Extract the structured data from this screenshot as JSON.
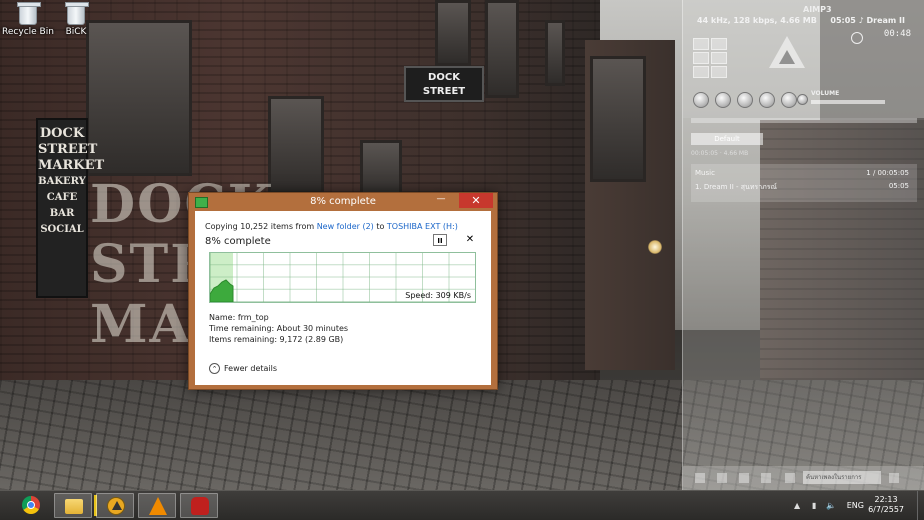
{
  "desktop": {
    "icons": [
      {
        "label": "Recycle Bin",
        "icon": "recycle-bin-icon"
      },
      {
        "label": "BiCK",
        "icon": "recycle-bin-icon"
      }
    ],
    "wallpaper_signs": {
      "board": [
        "DOCK",
        "STREET",
        "MARKET",
        "BAKERY",
        "CAFE",
        "BAR",
        "SOCIAL"
      ],
      "hanging": [
        "DOCK",
        "STREET"
      ],
      "big": [
        "DOCK",
        "STREET",
        "MARKET"
      ]
    }
  },
  "aimp": {
    "info": "44 kHz, 128 kbps, 4.66 MB",
    "logo_text": "AIMP3",
    "now_playing": "05:05 ♪ Dream II",
    "clock": "00:48",
    "volume_label": "VOLUME",
    "preset": "Default",
    "playlist_header": "00:05:05   ·   4.66 MB",
    "playlist_name": "Music",
    "playlist_count": "1 / 00:05:05",
    "track": "1. Dream II - สุนทราภรณ์",
    "track_time": "05:05",
    "search_placeholder": "ค้นหาเพลงในรายการ"
  },
  "dialog": {
    "title": "8% complete",
    "minimize_label": "—",
    "close_label": "✕",
    "copy_prefix": "Copying 10,252 items from ",
    "source": "New folder (2)",
    "copy_mid": " to ",
    "destination": "TOSHIBA EXT (H:)",
    "percent_label": "8% complete",
    "progress": 0.08,
    "pause_label": "II",
    "cancel_label": "✕",
    "speed": "Speed: 309 KB/s",
    "name": "Name:  frm_top",
    "time_remaining": "Time remaining:  About 30 minutes",
    "items_remaining": "Items remaining:  9,172 (2.89 GB)",
    "fewer_details": "Fewer details",
    "fewer_icon": "chevron-up-icon",
    "accent": "#b36f3d",
    "graph_fill": "#3daa3d"
  },
  "taskbar": {
    "apps": [
      {
        "name": "chrome",
        "icon": "chrome-icon"
      },
      {
        "name": "file-explorer",
        "icon": "folder-icon"
      },
      {
        "name": "aimp",
        "icon": "aimp-icon"
      },
      {
        "name": "vlc",
        "icon": "vlc-icon"
      },
      {
        "name": "app",
        "icon": "bag-icon"
      }
    ],
    "tray": {
      "up_arrow": "▲",
      "signal": "▮",
      "volume": "🔈",
      "language": "ENG",
      "time": "22:13",
      "date": "6/7/2557"
    }
  }
}
